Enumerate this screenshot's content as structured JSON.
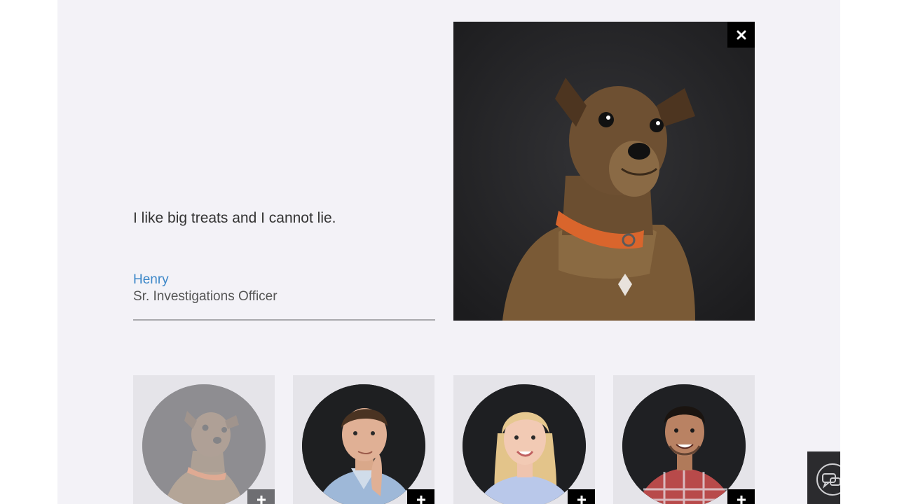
{
  "testimonial": {
    "quote": "I like big treats and I cannot lie.",
    "name": "Henry",
    "role": "Sr. Investigations Officer"
  },
  "feature": {
    "subject": "dog-portrait",
    "close_icon": "close-icon"
  },
  "team_cards": [
    {
      "subject": "dog-portrait",
      "active": true,
      "expand_icon": "plus-icon"
    },
    {
      "subject": "man-portrait",
      "active": false,
      "expand_icon": "plus-icon"
    },
    {
      "subject": "woman-portrait",
      "active": false,
      "expand_icon": "plus-icon"
    },
    {
      "subject": "young-man-portrait",
      "active": false,
      "expand_icon": "plus-icon"
    }
  ],
  "chat": {
    "icon": "chat-icon"
  },
  "colors": {
    "background": "#f3f2f7",
    "accent": "#3a86c8",
    "card": "#e5e4e9",
    "dark": "#000000"
  }
}
